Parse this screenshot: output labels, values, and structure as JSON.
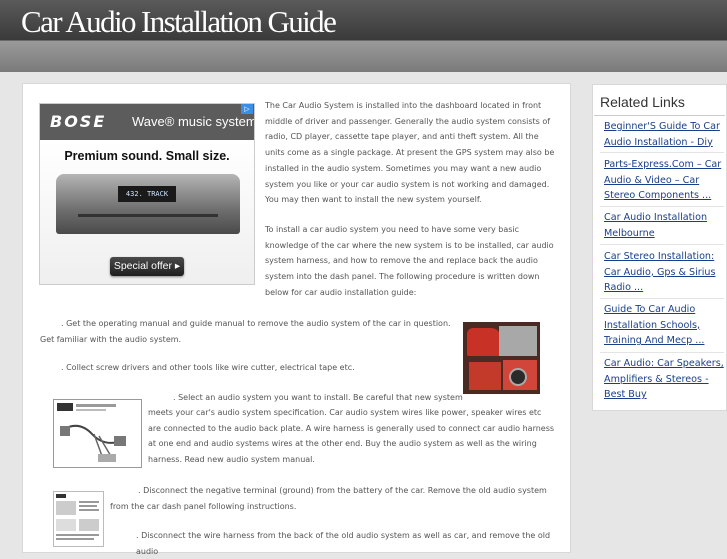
{
  "header": {
    "title": "Car Audio Installation Guide"
  },
  "ad": {
    "brand": "BOSE",
    "product": "Wave® music system",
    "headline": "Premium sound. Small size.",
    "display": "432. TRACK",
    "cta": "Special offer ▸",
    "adchoices": "▷"
  },
  "article": {
    "intro": "The Car Audio System is installed into the dashboard located in front middle of driver and passenger. Generally the audio system consists of radio, CD player, cassette tape player, and anti theft system. All the units come as a single package. At present the GPS system may also be installed in the audio system. Sometimes you may want a new audio system you like or your car audio system is not working and damaged. You may then want to install the new system yourself.",
    "install_intro": "To install a car audio system you need to have some very basic knowledge of the car where the new system is to be installed, car audio system harness, and how to remove the and replace back the audio system into the dash panel. The following procedure is written down below for car audio installation guide:",
    "step1": ". Get the operating manual and guide manual to remove the audio system of the car in question. Get familiar with the audio system.",
    "step2": ". Collect screw drivers and other tools like wire cutter, electrical tape etc.",
    "step3_lead": ". Select an audio system you want to install. Be careful that new system",
    "step3": "meets your car's audio system specification. Car audio system wires like power, speaker wires etc are connected to the audio back plate. A wire harness is generally used to connect car audio harness at one end and audio systems wires at the other end. Buy the audio system as well as the wiring harness. Read new audio system manual.",
    "step4": ". Disconnect the negative terminal (ground) from the battery of the car. Remove the old audio system from the car dash panel following instructions.",
    "step5": ". Disconnect the wire harness from the back of the old audio system as well as car, and remove the old audio"
  },
  "sidebar": {
    "title": "Related Links",
    "links": [
      "Beginner'S Guide To Car Audio Installation - Diy",
      "Parts-Express.Com – Car Audio & Video – Car Stereo Components ...",
      "Car Audio Installation Melbourne",
      "Car Stereo Installation: Car Audio, Gps & Sirius Radio ...",
      "Guide To Car Audio Installation Schools, Training And Mecp ...",
      "Car Audio: Car Speakers, Amplifiers & Stereos - Best Buy"
    ]
  },
  "colors": {
    "link": "#1a3f8a",
    "header_dark": "#3a3a3a",
    "body_text": "#555555"
  }
}
